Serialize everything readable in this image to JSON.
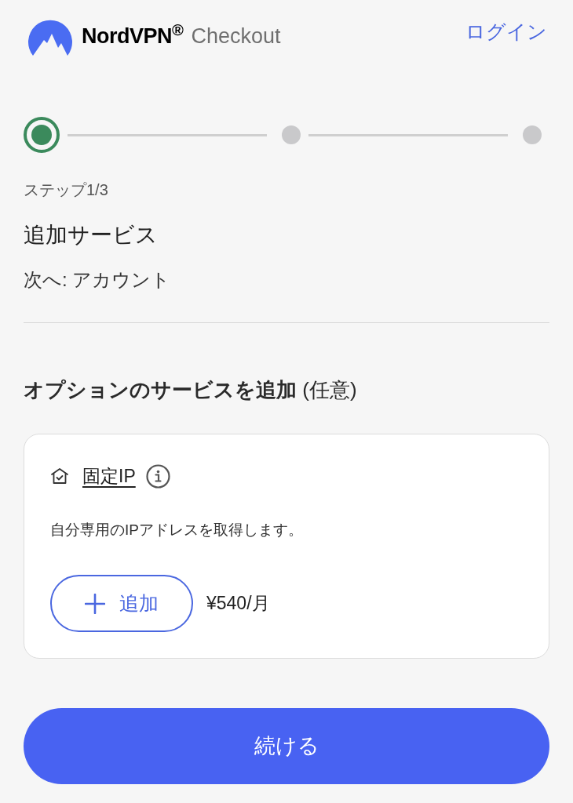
{
  "header": {
    "brand": "NordVPN$^{®}$",
    "subtitle": "Checkout",
    "login_link": "ログイン"
  },
  "stepper": {
    "steps": [
      {
        "selected": true
      },
      {
        "selected": false
      },
      {
        "selected": false
      }
    ]
  },
  "step_label": "ステップ1/3",
  "title": "追加サービス",
  "next_label": "次へ: アカウント",
  "section_title": "**オプションのサービスを追加** (任意)",
  "addons": [
    {
      "name": "固定IP",
      "description": "自分専用のIPアドレスを取得します。",
      "add_button": "追加",
      "price": "¥540/月"
    }
  ],
  "continue_button": "続ける"
}
